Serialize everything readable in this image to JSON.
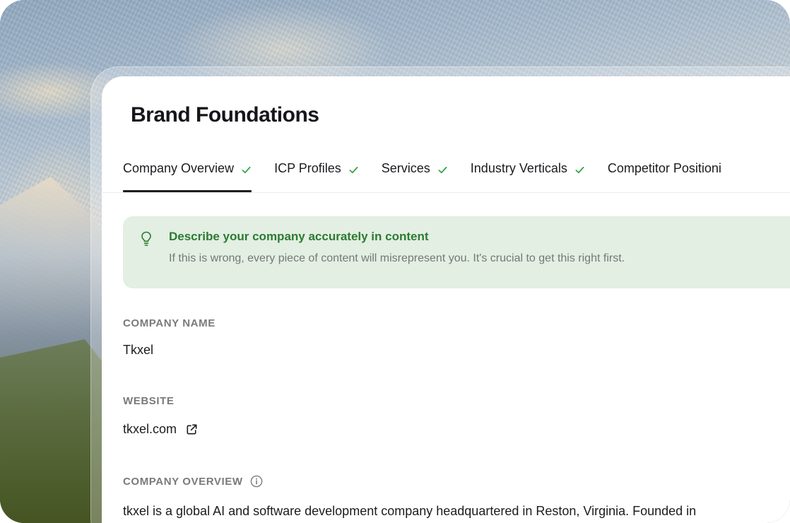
{
  "page": {
    "title": "Brand Foundations"
  },
  "tabs": [
    {
      "label": "Company Overview",
      "complete": true,
      "active": true
    },
    {
      "label": "ICP Profiles",
      "complete": true,
      "active": false
    },
    {
      "label": "Services",
      "complete": true,
      "active": false
    },
    {
      "label": "Industry Verticals",
      "complete": true,
      "active": false
    },
    {
      "label": "Competitor Positioni",
      "complete": false,
      "active": false
    }
  ],
  "callout": {
    "icon": "lightbulb-icon",
    "title": "Describe your company accurately in content",
    "text": "If this is wrong, every piece of content will misrepresent you. It's crucial to get this right first."
  },
  "fields": {
    "company_name": {
      "label": "COMPANY NAME",
      "value": "Tkxel"
    },
    "website": {
      "label": "WEBSITE",
      "value": "tkxel.com",
      "icon": "external-link-icon"
    },
    "company_overview": {
      "label": "COMPANY OVERVIEW",
      "icon": "info-icon",
      "value": "tkxel is a global AI and software development company headquartered in Reston, Virginia. Founded in"
    }
  },
  "colors": {
    "accent_green": "#2d7a32",
    "callout_bg": "#e2efe2",
    "check_green": "#2fa444",
    "text_primary": "#1b1c20",
    "label_gray": "#7a7a7a"
  }
}
